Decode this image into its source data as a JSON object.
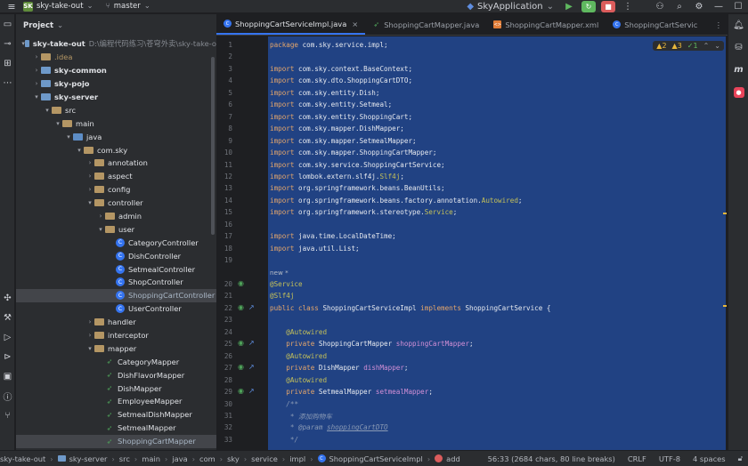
{
  "titlebar": {
    "project_badge": "SK",
    "project_name": "sky-take-out",
    "branch": "master",
    "run_config": "SkyApplication"
  },
  "project_panel": {
    "title": "Project",
    "tree": [
      {
        "indent": 0,
        "arrow": "▾",
        "kind": "folder-blue",
        "label": "sky-take-out",
        "hint": "D:\\编程代码练习\\苍穹外卖\\sky-take-o",
        "bold": true
      },
      {
        "indent": 1,
        "arrow": "›",
        "kind": "folder",
        "label": ".idea",
        "dim": true
      },
      {
        "indent": 1,
        "arrow": "›",
        "kind": "folder-blue",
        "label": "sky-common",
        "bold": true
      },
      {
        "indent": 1,
        "arrow": "›",
        "kind": "folder-blue",
        "label": "sky-pojo",
        "bold": true
      },
      {
        "indent": 1,
        "arrow": "▾",
        "kind": "folder-blue",
        "label": "sky-server",
        "bold": true
      },
      {
        "indent": 2,
        "arrow": "▾",
        "kind": "folder",
        "label": "src"
      },
      {
        "indent": 3,
        "arrow": "▾",
        "kind": "folder",
        "label": "main"
      },
      {
        "indent": 4,
        "arrow": "▾",
        "kind": "folder-src",
        "label": "java"
      },
      {
        "indent": 5,
        "arrow": "▾",
        "kind": "folder",
        "label": "com.sky"
      },
      {
        "indent": 6,
        "arrow": "›",
        "kind": "folder",
        "label": "annotation"
      },
      {
        "indent": 6,
        "arrow": "›",
        "kind": "folder",
        "label": "aspect"
      },
      {
        "indent": 6,
        "arrow": "›",
        "kind": "folder",
        "label": "config"
      },
      {
        "indent": 6,
        "arrow": "▾",
        "kind": "folder",
        "label": "controller"
      },
      {
        "indent": 7,
        "arrow": "›",
        "kind": "folder",
        "label": "admin"
      },
      {
        "indent": 7,
        "arrow": "▾",
        "kind": "folder",
        "label": "user"
      },
      {
        "indent": 8,
        "arrow": "",
        "kind": "class",
        "label": "CategoryController"
      },
      {
        "indent": 8,
        "arrow": "",
        "kind": "class",
        "label": "DishController"
      },
      {
        "indent": 8,
        "arrow": "",
        "kind": "class",
        "label": "SetmealController"
      },
      {
        "indent": 8,
        "arrow": "",
        "kind": "class",
        "label": "ShopController"
      },
      {
        "indent": 8,
        "arrow": "",
        "kind": "class",
        "label": "ShoppingCartController",
        "selected": true,
        "muted": true
      },
      {
        "indent": 8,
        "arrow": "",
        "kind": "class",
        "label": "UserController"
      },
      {
        "indent": 6,
        "arrow": "›",
        "kind": "folder",
        "label": "handler"
      },
      {
        "indent": 6,
        "arrow": "›",
        "kind": "folder",
        "label": "interceptor"
      },
      {
        "indent": 6,
        "arrow": "▾",
        "kind": "folder",
        "label": "mapper"
      },
      {
        "indent": 7,
        "arrow": "",
        "kind": "mapper",
        "label": "CategoryMapper"
      },
      {
        "indent": 7,
        "arrow": "",
        "kind": "mapper",
        "label": "DishFlavorMapper"
      },
      {
        "indent": 7,
        "arrow": "",
        "kind": "mapper",
        "label": "DishMapper"
      },
      {
        "indent": 7,
        "arrow": "",
        "kind": "mapper",
        "label": "EmployeeMapper"
      },
      {
        "indent": 7,
        "arrow": "",
        "kind": "mapper",
        "label": "SetmealDishMapper"
      },
      {
        "indent": 7,
        "arrow": "",
        "kind": "mapper",
        "label": "SetmealMapper"
      },
      {
        "indent": 7,
        "arrow": "",
        "kind": "mapper",
        "label": "ShoppingCartMapper",
        "selected": true,
        "muted": true
      }
    ]
  },
  "tabs": [
    {
      "label": "ShoppingCartServiceImpl.java",
      "icon": "class",
      "active": true
    },
    {
      "label": "ShoppingCartMapper.java",
      "icon": "mapper"
    },
    {
      "label": "ShoppingCartMapper.xml",
      "icon": "xml"
    },
    {
      "label": "ShoppingCartServic",
      "icon": "class"
    }
  ],
  "inspections": {
    "warnings": "2",
    "weak_warnings": "3",
    "typos": "1"
  },
  "code": [
    {
      "n": "1",
      "html": "<span class=\"kw\">package</span> com.sky.service.impl;"
    },
    {
      "n": "2",
      "html": ""
    },
    {
      "n": "3",
      "html": "<span class=\"kw\">import</span> com.sky.context.BaseContext;"
    },
    {
      "n": "4",
      "html": "<span class=\"kw\">import</span> com.sky.dto.ShoppingCartDTO;"
    },
    {
      "n": "5",
      "html": "<span class=\"kw\">import</span> com.sky.entity.Dish;"
    },
    {
      "n": "6",
      "html": "<span class=\"kw\">import</span> com.sky.entity.Setmeal;"
    },
    {
      "n": "7",
      "html": "<span class=\"kw\">import</span> com.sky.entity.ShoppingCart;"
    },
    {
      "n": "8",
      "html": "<span class=\"kw\">import</span> com.sky.mapper.DishMapper;"
    },
    {
      "n": "9",
      "html": "<span class=\"kw\">import</span> com.sky.mapper.SetmealMapper;"
    },
    {
      "n": "10",
      "html": "<span class=\"kw\">import</span> com.sky.mapper.ShoppingCartMapper;"
    },
    {
      "n": "11",
      "html": "<span class=\"kw\">import</span> com.sky.service.ShoppingCartService;"
    },
    {
      "n": "12",
      "html": "<span class=\"kw\">import</span> lombok.extern.slf4j.<span class=\"ann\">Slf4j</span>;"
    },
    {
      "n": "13",
      "html": "<span class=\"kw\">import</span> org.springframework.beans.BeanUtils;"
    },
    {
      "n": "14",
      "html": "<span class=\"kw\">import</span> org.springframework.beans.factory.annotation.<span class=\"ann\">Autowired</span>;"
    },
    {
      "n": "15",
      "html": "<span class=\"kw\">import</span> org.springframework.stereotype.<span class=\"ann\">Service</span>;"
    },
    {
      "n": "16",
      "html": ""
    },
    {
      "n": "17",
      "html": "<span class=\"kw\">import</span> java.time.LocalDateTime;"
    },
    {
      "n": "18",
      "html": "<span class=\"kw\">import</span> java.util.List;"
    },
    {
      "n": "19",
      "html": ""
    },
    {
      "n": "",
      "html": "<span class=\"new-hint\">new *</span>"
    },
    {
      "n": "20",
      "html": "<span class=\"ann\">@Service</span>"
    },
    {
      "n": "21",
      "html": "<span class=\"ann\">@Slf4j</span>"
    },
    {
      "n": "22",
      "html": "<span class=\"kw\">public class</span> ShoppingCartServiceImpl <span class=\"kw\">implements</span> ShoppingCartService {"
    },
    {
      "n": "23",
      "html": ""
    },
    {
      "n": "24",
      "html": "    <span class=\"ann\">@Autowired</span>"
    },
    {
      "n": "25",
      "html": "    <span class=\"kw\">private</span> ShoppingCartMapper <span class=\"fld\">shoppingCartMapper</span>;"
    },
    {
      "n": "26",
      "html": "    <span class=\"ann\">@Autowired</span>"
    },
    {
      "n": "27",
      "html": "    <span class=\"kw\">private</span> DishMapper <span class=\"fld\">dishMapper</span>;"
    },
    {
      "n": "28",
      "html": "    <span class=\"ann\">@Autowired</span>"
    },
    {
      "n": "29",
      "html": "    <span class=\"kw\">private</span> SetmealMapper <span class=\"fld\">setmealMapper</span>;"
    },
    {
      "n": "30",
      "html": "    <span class=\"cmt\">/**</span>"
    },
    {
      "n": "31",
      "html": "    <span class=\"cmt\"> * 添加购物车</span>"
    },
    {
      "n": "32",
      "html": "    <span class=\"cmt\"> * @param <u>shoppingCartDTO</u></span>"
    },
    {
      "n": "33",
      "html": "    <span class=\"cmt\"> */</span>"
    }
  ],
  "statusbar": {
    "crumbs": [
      "sky-take-out",
      "sky-server",
      "src",
      "main",
      "java",
      "com",
      "sky",
      "service",
      "impl",
      "ShoppingCartServiceImpl",
      "add"
    ],
    "position": "56:33 (2684 chars, 80 line breaks)",
    "line_sep": "CRLF",
    "encoding": "UTF-8",
    "indent": "4 spaces"
  }
}
